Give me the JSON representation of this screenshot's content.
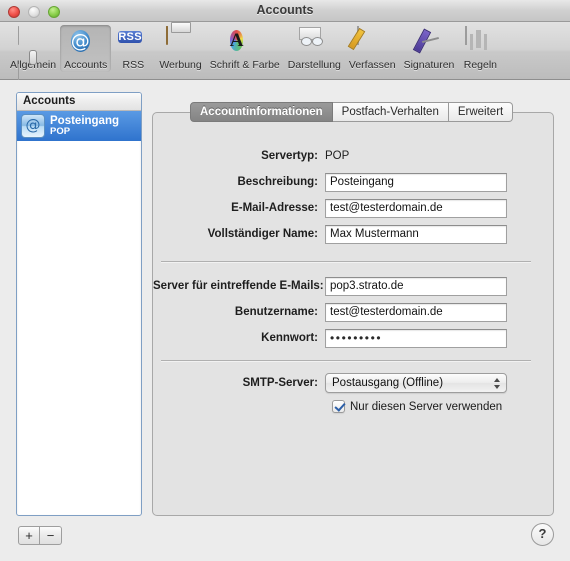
{
  "window": {
    "title": "Accounts",
    "controls": {
      "close": "close-button",
      "minimize": "minimize-button",
      "zoom": "zoom-button"
    }
  },
  "toolbar": {
    "items": [
      {
        "label": "Allgemein",
        "icon": "general-switch-icon",
        "selected": false
      },
      {
        "label": "Accounts",
        "icon": "at-sign-icon",
        "selected": true
      },
      {
        "label": "RSS",
        "icon": "rss-icon",
        "selected": false
      },
      {
        "label": "Werbung",
        "icon": "junk-mail-bin-icon",
        "selected": false
      },
      {
        "label": "Schrift & Farbe",
        "icon": "font-color-icon",
        "selected": false
      },
      {
        "label": "Darstellung",
        "icon": "viewing-glasses-icon",
        "selected": false
      },
      {
        "label": "Verfassen",
        "icon": "compose-pencil-icon",
        "selected": false
      },
      {
        "label": "Signaturen",
        "icon": "signature-pen-icon",
        "selected": false
      },
      {
        "label": "Regeln",
        "icon": "rules-fan-icon",
        "selected": false
      }
    ]
  },
  "account_list": {
    "header": "Accounts",
    "rows": [
      {
        "name": "Posteingang",
        "type": "POP",
        "icon": "at-sign-icon",
        "selected": true
      }
    ],
    "add_label": "+",
    "remove_label": "−"
  },
  "tabs": [
    {
      "label": "Accountinformationen",
      "selected": true
    },
    {
      "label": "Postfach-Verhalten",
      "selected": false
    },
    {
      "label": "Erweitert",
      "selected": false
    }
  ],
  "form": {
    "servertyp": {
      "label": "Servertyp:",
      "value": "POP"
    },
    "beschreibung": {
      "label": "Beschreibung:",
      "value": "Posteingang"
    },
    "email": {
      "label": "E-Mail-Adresse:",
      "value": "test@testerdomain.de"
    },
    "vollname": {
      "label": "Vollständiger Name:",
      "value": "Max Mustermann"
    },
    "incoming_server": {
      "label": "Server für eintreffende E-Mails:",
      "value": "pop3.strato.de"
    },
    "benutzername": {
      "label": "Benutzername:",
      "value": "test@testerdomain.de"
    },
    "kennwort": {
      "label": "Kennwort:",
      "value": "•••••••••"
    },
    "smtp": {
      "label": "SMTP-Server:",
      "value": "Postausgang (Offline)",
      "options": [
        "Postausgang (Offline)"
      ]
    },
    "only_this_server": {
      "label": "Nur diesen Server verwenden",
      "checked": true
    }
  },
  "help": {
    "label": "?"
  },
  "colors": {
    "selection_blue": "#2f73cd",
    "tab_selected": "#8f8f8f",
    "panel_bg": "#e3e3e3",
    "window_bg": "#ececec"
  }
}
